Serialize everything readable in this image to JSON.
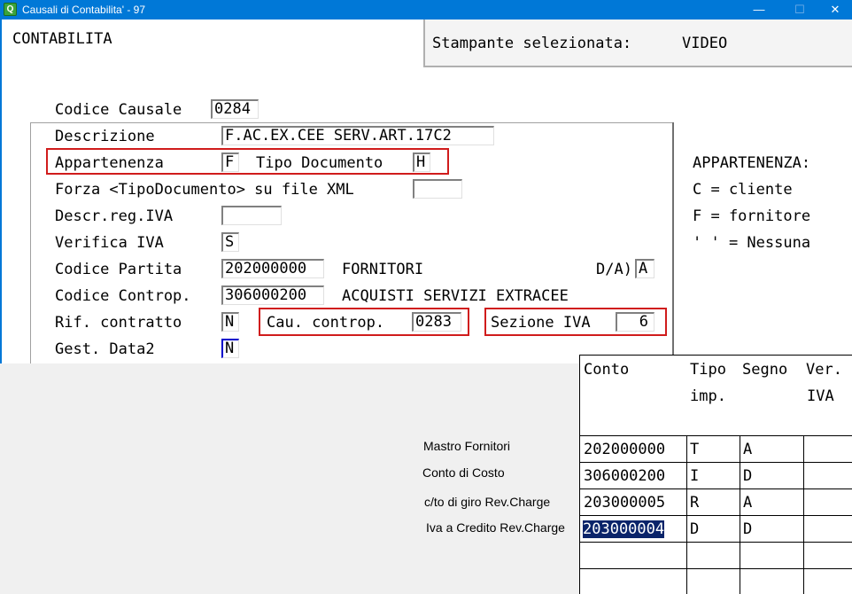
{
  "window": {
    "title": "Causali di Contabilita' - 97",
    "app_icon": "Q",
    "controls": [
      "minimize",
      "maximize",
      "close"
    ]
  },
  "header": {
    "module": "CONTABILITA",
    "printer_label": "Stampante selezionata:",
    "printer_value": "VIDEO"
  },
  "form": {
    "codice_causale": {
      "label": "Codice Causale",
      "value": "0284"
    },
    "descrizione": {
      "label": "Descrizione",
      "value": "F.AC.EX.CEE SERV.ART.17C2"
    },
    "appartenenza": {
      "label": "Appartenenza",
      "value": "F"
    },
    "tipo_documento": {
      "label": "Tipo Documento",
      "value": "H"
    },
    "forza_tipo": {
      "label": "Forza <TipoDocumento> su file XML",
      "value": ""
    },
    "descr_reg_iva": {
      "label": "Descr.reg.IVA",
      "value": ""
    },
    "verifica_iva": {
      "label": "Verifica IVA",
      "value": "S"
    },
    "codice_partita": {
      "label": "Codice Partita",
      "value": "202000000",
      "desc": "FORNITORI",
      "da_label": "D/A)",
      "da_value": "A"
    },
    "codice_controp": {
      "label": "Codice Controp.",
      "value": "306000200",
      "desc": "ACQUISTI SERVIZI EXTRACEE"
    },
    "rif_contratto": {
      "label": "Rif. contratto",
      "value": "N"
    },
    "cau_controp": {
      "label": "Cau. controp.",
      "value": "0283"
    },
    "sezione_iva": {
      "label": "Sezione IVA",
      "value": "6"
    },
    "gest_data2": {
      "label": "Gest. Data2",
      "value": "N"
    }
  },
  "legend": {
    "title": "APPARTENENZA:",
    "lines": [
      "C = cliente",
      "F = fornitore",
      "' ' = Nessuna"
    ]
  },
  "table": {
    "headers": {
      "conto": "Conto",
      "tipo": "Tipo",
      "tipo2": "imp.",
      "segno": "Segno",
      "ver": "Ver.",
      "ver2": "IVA"
    },
    "rows": [
      {
        "label": "Mastro Fornitori",
        "conto": "202000000",
        "tipo": "T",
        "segno": "A",
        "ver": ""
      },
      {
        "label": "Conto di Costo",
        "conto": "306000200",
        "tipo": "I",
        "segno": "D",
        "ver": ""
      },
      {
        "label": "c/to  di giro  Rev.Charge",
        "conto": "203000005",
        "tipo": "R",
        "segno": "A",
        "ver": ""
      },
      {
        "label": "Iva a Credito Rev.Charge",
        "conto": "203000004",
        "tipo": "D",
        "segno": "D",
        "ver": ""
      }
    ]
  },
  "colors": {
    "titlebar": "#0078d7",
    "highlight_box": "#d01c1c",
    "selection": "#0a246a"
  }
}
